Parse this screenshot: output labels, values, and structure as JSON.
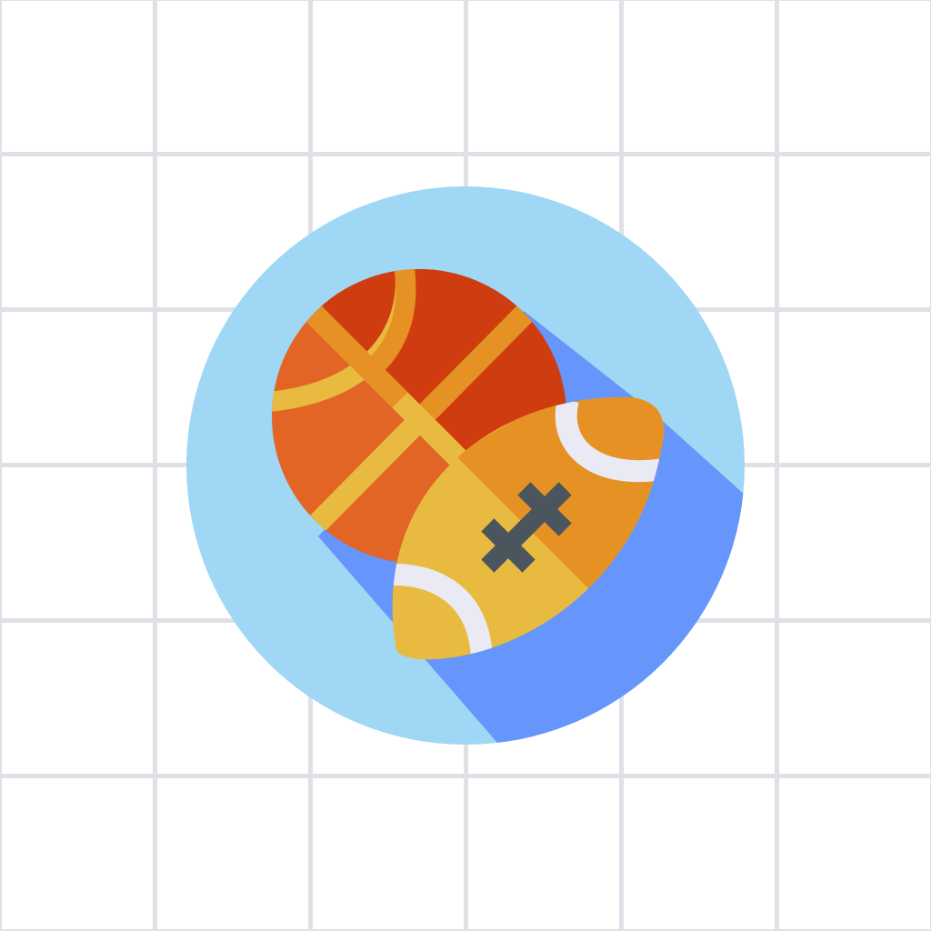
{
  "canvas": {
    "background_color": "#ffffff",
    "grid_line_color": "#dfe1e7"
  },
  "icon": {
    "name": "basketball-and-american-football-icon",
    "colors": {
      "circle": "#9fd7f4",
      "long_shadow": "#6695fb",
      "basketball_dark": "#cf3c10",
      "basketball_light": "#e26526",
      "basketball_seam": "#e8bb40",
      "football_left": "#e8bb40",
      "football_right": "#e69124",
      "football_stripe": "#eaeaf4",
      "football_lace": "#4b555d"
    }
  }
}
